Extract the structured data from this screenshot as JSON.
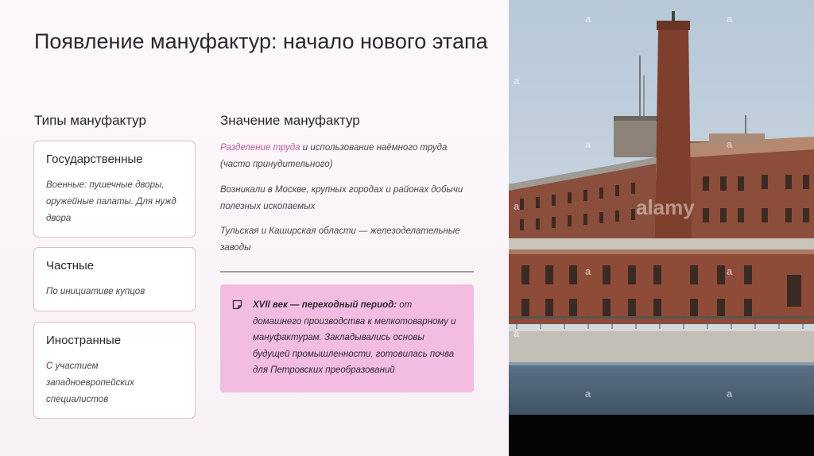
{
  "title": "Появление мануфактур: начало нового этапа",
  "types": {
    "heading": "Типы мануфактур",
    "cards": [
      {
        "title": "Государственные",
        "text": "Военные: пушечные дворы, оружейные палаты. Для нужд двора"
      },
      {
        "title": "Частные",
        "text": "По инициативе купцов"
      },
      {
        "title": "Иностранные",
        "text": "С участием западноевропейских специалистов"
      }
    ]
  },
  "significance": {
    "heading": "Значение мануфактур",
    "p1_highlight": "Разделение труда",
    "p1_rest": " и использование наёмного труда (часто принудительного)",
    "p2": "Возникали в Москве, крупных городах и районах добычи полезных ископаемых",
    "p3": "Тульская и Каширская области — железоделательные заводы"
  },
  "callout": {
    "bold": "XVII век — переходный период:",
    "text": " от домашнего производства к мелкотоварному и мануфактурам. Закладывались основы будущей промышленности, готовилась почва для Петровских преобразований",
    "icon": "note-icon"
  },
  "photo": {
    "watermark": "a",
    "watermark_brand": "alamy"
  },
  "colors": {
    "accent": "#c05aa6",
    "callout_bg": "#f3bde1",
    "card_border": "#dcbcd2"
  }
}
